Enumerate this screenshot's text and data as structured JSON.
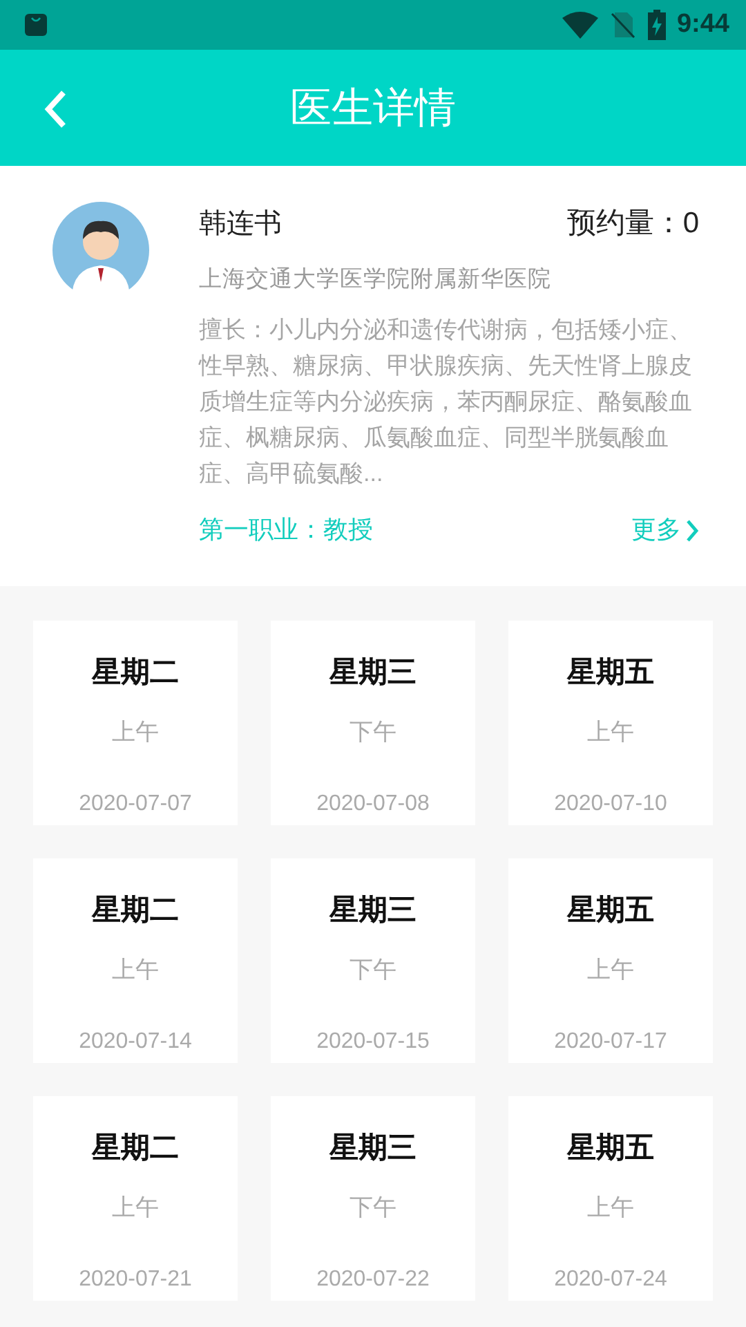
{
  "status_bar": {
    "time": "9:44"
  },
  "app_bar": {
    "title": "医生详情"
  },
  "doctor": {
    "name": "韩连书",
    "appointments": "预约量：0",
    "hospital": "上海交通大学医学院附属新华医院",
    "specialty": "擅长：小儿内分泌和遗传代谢病，包括矮小症、性早熟、糖尿病、甲状腺疾病、先天性肾上腺皮质增生症等内分泌疾病，苯丙酮尿症、酪氨酸血症、枫糖尿病、瓜氨酸血症、同型半胱氨酸血症、高甲硫氨酸...",
    "title": "第一职业：教授",
    "more": "更多"
  },
  "schedule": [
    {
      "weekday": "星期二",
      "period": "上午",
      "date": "2020-07-07"
    },
    {
      "weekday": "星期三",
      "period": "下午",
      "date": "2020-07-08"
    },
    {
      "weekday": "星期五",
      "period": "上午",
      "date": "2020-07-10"
    },
    {
      "weekday": "星期二",
      "period": "上午",
      "date": "2020-07-14"
    },
    {
      "weekday": "星期三",
      "period": "下午",
      "date": "2020-07-15"
    },
    {
      "weekday": "星期五",
      "period": "上午",
      "date": "2020-07-17"
    },
    {
      "weekday": "星期二",
      "period": "上午",
      "date": "2020-07-21"
    },
    {
      "weekday": "星期三",
      "period": "下午",
      "date": "2020-07-22"
    },
    {
      "weekday": "星期五",
      "period": "上午",
      "date": "2020-07-24"
    }
  ]
}
